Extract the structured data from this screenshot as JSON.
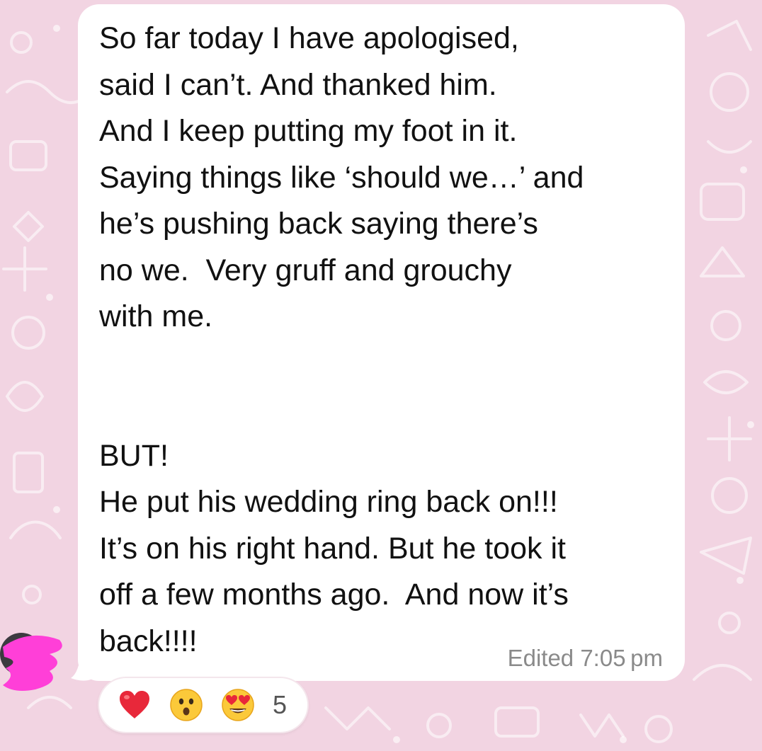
{
  "message": {
    "text": "So far today I have apologised,\nsaid I can’t. And thanked him.\nAnd I keep putting my foot in it.\nSaying things like ‘should we…’ and\nhe’s pushing back saying there’s\nno we.  Very gruff and grouchy\nwith me.\n\n\nBUT!\nHe put his wedding ring back on!!!\nIt’s on his right hand. But he took it\noff a few months ago.  And now it’s\nback!!!!",
    "meta": "Edited 7:05 pm"
  },
  "reactions": {
    "icons": [
      "red-heart",
      "hushed-face",
      "heart-eyes-face"
    ],
    "count": "5"
  },
  "colors": {
    "wallpaper": "#f2d4e2",
    "bubble": "#ffffff",
    "redaction": "#ff3fd8"
  }
}
